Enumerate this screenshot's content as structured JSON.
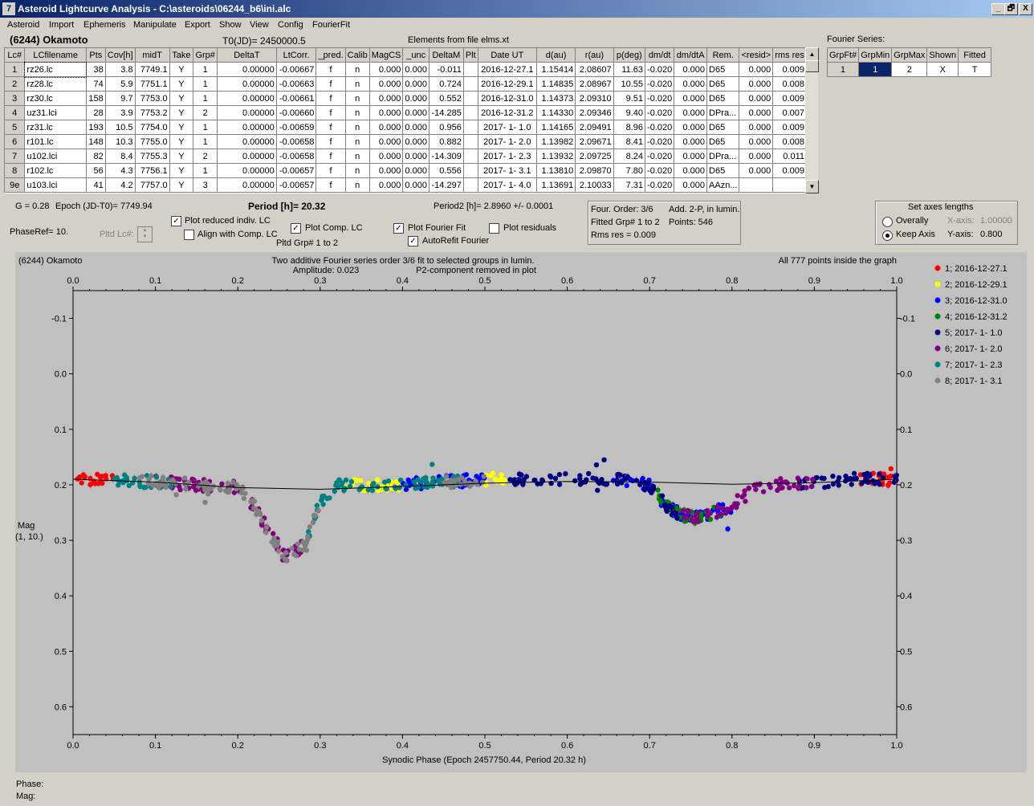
{
  "window": {
    "title": "Asteroid Lightcurve Analysis - C:\\asteroids\\06244_b6\\ini.alc",
    "icon": "calculator-icon",
    "minimize": "_",
    "maximize": "🗗",
    "close": "X"
  },
  "menu": [
    "Asteroid",
    "Import",
    "Ephemeris",
    "Manipulate",
    "Export",
    "Show",
    "View",
    "Config",
    "FourierFit"
  ],
  "header": {
    "asteroid_name": "(6244) Okamoto",
    "t0": "T0(JD)= 2450000.5",
    "elements": "Elements from file elms.xt"
  },
  "lc_table": {
    "columns": [
      "Lc#",
      "LCfilename",
      "Pts",
      "Cov[h]",
      "midT",
      "Take",
      "Grp#",
      "DeltaT",
      "LtCorr.",
      "_pred.",
      "Calib",
      "MagCS",
      "_unc",
      "DeltaM",
      "Plt",
      "Date UT",
      "d(au)",
      "r(au)",
      "p(deg)",
      "dm/dt",
      "dm/dtA",
      "Rem.",
      "<resid>",
      "rms res"
    ],
    "rows": [
      [
        "1",
        "rz26.lc",
        "38",
        "3.8",
        "7749.1",
        "Y",
        "1",
        "0.00000",
        "-0.00667",
        "f",
        "n",
        "0.000",
        "0.000",
        "-0.011",
        "",
        "2016-12-27.1",
        "1.15414",
        "2.08607",
        "11.63",
        "-0.020",
        "0.000",
        "D65",
        "0.000",
        "0.009"
      ],
      [
        "2",
        "rz28.lc",
        "74",
        "5.9",
        "7751.1",
        "Y",
        "1",
        "0.00000",
        "-0.00663",
        "f",
        "n",
        "0.000",
        "0.000",
        "0.724",
        "",
        "2016-12-29.1",
        "1.14835",
        "2.08967",
        "10.55",
        "-0.020",
        "0.000",
        "D65",
        "0.000",
        "0.008"
      ],
      [
        "3",
        "rz30.lc",
        "158",
        "9.7",
        "7753.0",
        "Y",
        "1",
        "0.00000",
        "-0.00661",
        "f",
        "n",
        "0.000",
        "0.000",
        "0.552",
        "",
        "2016-12-31.0",
        "1.14373",
        "2.09310",
        "9.51",
        "-0.020",
        "0.000",
        "D65",
        "0.000",
        "0.009"
      ],
      [
        "4",
        "uz31.lci",
        "28",
        "3.9",
        "7753.2",
        "Y",
        "2",
        "0.00000",
        "-0.00660",
        "f",
        "n",
        "0.000",
        "0.000",
        "-14.285",
        "",
        "2016-12-31.2",
        "1.14330",
        "2.09346",
        "9.40",
        "-0.020",
        "0.000",
        "DPra...",
        "0.000",
        "0.007"
      ],
      [
        "5",
        "rz31.lc",
        "193",
        "10.5",
        "7754.0",
        "Y",
        "1",
        "0.00000",
        "-0.00659",
        "f",
        "n",
        "0.000",
        "0.000",
        "0.956",
        "",
        "2017- 1- 1.0",
        "1.14165",
        "2.09491",
        "8.96",
        "-0.020",
        "0.000",
        "D65",
        "0.000",
        "0.009"
      ],
      [
        "6",
        "r101.lc",
        "148",
        "10.3",
        "7755.0",
        "Y",
        "1",
        "0.00000",
        "-0.00658",
        "f",
        "n",
        "0.000",
        "0.000",
        "0.882",
        "",
        "2017- 1- 2.0",
        "1.13982",
        "2.09671",
        "8.41",
        "-0.020",
        "0.000",
        "D65",
        "0.000",
        "0.008"
      ],
      [
        "7",
        "u102.lci",
        "82",
        "8.4",
        "7755.3",
        "Y",
        "2",
        "0.00000",
        "-0.00658",
        "f",
        "n",
        "0.000",
        "0.000",
        "-14.309",
        "",
        "2017- 1- 2.3",
        "1.13932",
        "2.09725",
        "8.24",
        "-0.020",
        "0.000",
        "DPra...",
        "0.000",
        "0.011"
      ],
      [
        "8",
        "r102.lc",
        "56",
        "4.3",
        "7756.1",
        "Y",
        "1",
        "0.00000",
        "-0.00657",
        "f",
        "n",
        "0.000",
        "0.000",
        "0.556",
        "",
        "2017- 1- 3.1",
        "1.13810",
        "2.09870",
        "7.80",
        "-0.020",
        "0.000",
        "D65",
        "0.000",
        "0.009"
      ],
      [
        "9e",
        "u103.lci",
        "41",
        "4.2",
        "7757.0",
        "Y",
        "3",
        "0.00000",
        "-0.00657",
        "f",
        "n",
        "0.000",
        "0.000",
        "-14.297",
        "",
        "2017- 1- 4.0",
        "1.13691",
        "2.10033",
        "7.31",
        "-0.020",
        "0.000",
        "AAzn...",
        "",
        ""
      ]
    ]
  },
  "fourier": {
    "label": "Fourier Series:",
    "columns": [
      "GrpFt#",
      "GrpMin",
      "GrpMax",
      "Shown",
      "Fitted"
    ],
    "row": [
      "1",
      "1",
      "2",
      "X",
      "T"
    ]
  },
  "controls": {
    "g": "G = 0.28",
    "epoch": "Epoch (JD-T0)= 7749.94",
    "period": "Period [h]= 20.32",
    "period2": "Period2 [h]= 2.8960 +/- 0.0001",
    "phaseref": "PhaseRef= 10.",
    "pltd_lc": "Pltd Lc#:",
    "plot_reduced": "Plot reduced indiv. LC",
    "align_comp": "Align with Comp. LC",
    "plot_comp": "Plot Comp. LC",
    "pltd_grp": "Pltd Grp#  1   to   2",
    "plot_fourier": "Plot Fourier Fit",
    "autorefit": "AutoRefit Fourier",
    "plot_residuals": "Plot residuals",
    "check_mark": "✓"
  },
  "info_box": {
    "four_order": "Four. Order:  3/6",
    "add_2p": "Add. 2-P, in lumin.",
    "fitted_grp": "Fitted Grp# 1 to 2",
    "points": "Points: 546",
    "rms": "Rms res     = 0.009"
  },
  "axes_box": {
    "title": "Set axes lengths",
    "overally": "Overally",
    "keep_axis": "Keep Axis",
    "x_axis_label": "X-axis:",
    "x_axis_value": "1.00000",
    "y_axis_label": "Y-axis:",
    "y_axis_value": "0.800"
  },
  "plot": {
    "asteroid": "(6244) Okamoto",
    "title1": "Two additive Fourier series order 3/6 fit to selected groups in lumin.",
    "title2": "Amplitude: 0.023",
    "title3": "P2-component removed in plot",
    "inside": "All 777 points inside the graph"
  },
  "chart_data": {
    "type": "scatter",
    "xlabel": "Synodic Phase (Epoch 2457750.44, Period 20.32 h)",
    "ylabel": "Mag",
    "ylabel2": "(1, 10.)",
    "xlim": [
      0.0,
      1.0
    ],
    "ylim": [
      -0.15,
      0.65
    ],
    "y_inverted": true,
    "x_ticks": [
      "0.0",
      "0.1",
      "0.2",
      "0.3",
      "0.4",
      "0.5",
      "0.6",
      "0.7",
      "0.8",
      "0.9",
      "1.0"
    ],
    "y_ticks": [
      "-0.1",
      "0.0",
      "0.1",
      "0.2",
      "0.3",
      "0.4",
      "0.5",
      "0.6"
    ],
    "series": [
      {
        "name": "1; 2016-12-27.1",
        "color": "#ff0000",
        "ranges": [
          [
            0.0,
            0.05
          ],
          [
            0.95,
            1.0
          ]
        ]
      },
      {
        "name": "2; 2016-12-29.1",
        "color": "#ffff00",
        "ranges": [
          [
            0.33,
            0.4
          ],
          [
            0.5,
            0.53
          ]
        ]
      },
      {
        "name": "3; 2016-12-31.0",
        "color": "#0000ff",
        "ranges": [
          [
            0.4,
            0.5
          ],
          [
            0.65,
            0.8
          ]
        ]
      },
      {
        "name": "4; 2016-12-31.2",
        "color": "#008000",
        "ranges": [
          [
            0.71,
            0.79
          ]
        ]
      },
      {
        "name": "5; 2017- 1- 1.0",
        "color": "#000080",
        "ranges": [
          [
            0.53,
            0.74
          ],
          [
            0.88,
            1.0
          ]
        ]
      },
      {
        "name": "6; 2017- 1- 2.0",
        "color": "#800080",
        "ranges": [
          [
            0.1,
            0.28
          ],
          [
            0.74,
            0.9
          ]
        ]
      },
      {
        "name": "7; 2017- 1- 2.3",
        "color": "#008080",
        "ranges": [
          [
            0.05,
            0.12
          ],
          [
            0.28,
            0.47
          ]
        ]
      },
      {
        "name": "8; 2017- 1- 3.1",
        "color": "#808080",
        "ranges": [
          [
            0.08,
            0.3
          ],
          [
            0.45,
            0.5
          ]
        ]
      }
    ],
    "fit_curve": {
      "x": [
        0.0,
        0.1,
        0.2,
        0.3,
        0.4,
        0.5,
        0.6,
        0.7,
        0.8,
        0.9,
        1.0
      ],
      "y": [
        0.19,
        0.195,
        0.205,
        0.208,
        0.203,
        0.197,
        0.194,
        0.195,
        0.199,
        0.196,
        0.19
      ]
    },
    "lightcurve": {
      "x": [
        0.0,
        0.05,
        0.1,
        0.15,
        0.2,
        0.22,
        0.24,
        0.26,
        0.28,
        0.3,
        0.32,
        0.35,
        0.4,
        0.45,
        0.5,
        0.55,
        0.6,
        0.65,
        0.7,
        0.72,
        0.74,
        0.76,
        0.78,
        0.8,
        0.82,
        0.85,
        0.9,
        0.95,
        1.0
      ],
      "y": [
        0.19,
        0.19,
        0.195,
        0.2,
        0.205,
        0.24,
        0.29,
        0.33,
        0.31,
        0.23,
        0.2,
        0.2,
        0.2,
        0.195,
        0.19,
        0.19,
        0.19,
        0.19,
        0.2,
        0.24,
        0.255,
        0.26,
        0.25,
        0.24,
        0.21,
        0.2,
        0.195,
        0.19,
        0.19
      ]
    }
  },
  "status": {
    "phase": "Phase:",
    "mag": "Mag:"
  }
}
